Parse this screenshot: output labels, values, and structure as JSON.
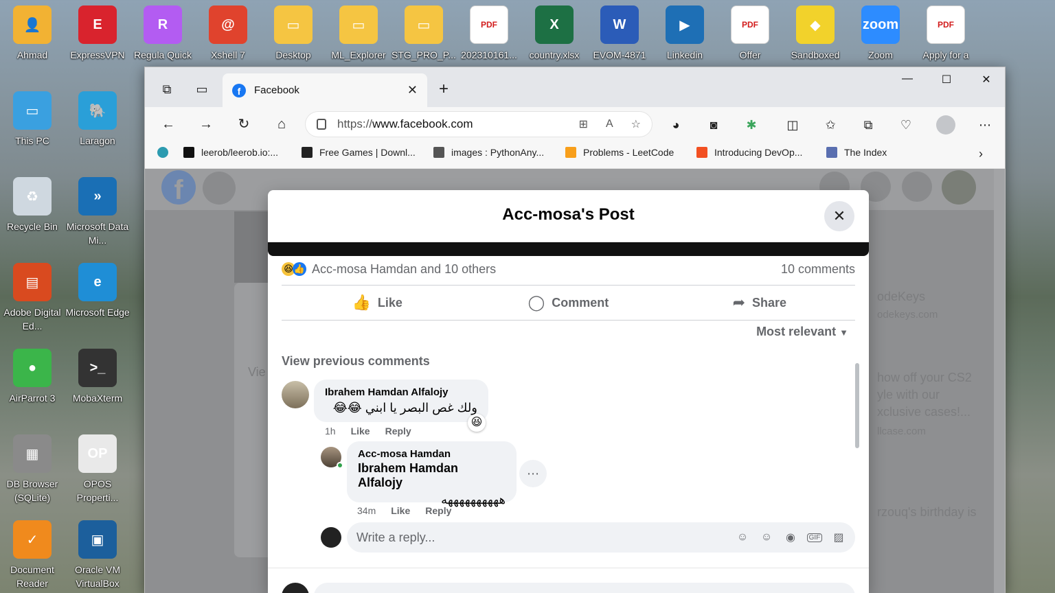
{
  "desktop": {
    "top_icons": [
      {
        "label": "Ahmad",
        "color": "#f2b233",
        "glyph": "👤"
      },
      {
        "label": "ExpressVPN",
        "color": "#d9232d",
        "glyph": "E"
      },
      {
        "label": "Regula Quick",
        "color": "#b35cf2",
        "glyph": "R"
      },
      {
        "label": "Xshell 7",
        "color": "#e0432d",
        "glyph": "@"
      },
      {
        "label": "Desktop",
        "color": "#f5c542",
        "glyph": "▭"
      },
      {
        "label": "ML_Explorer",
        "color": "#f5c542",
        "glyph": "▭"
      },
      {
        "label": "STG_PRO_P...",
        "color": "#f5c542",
        "glyph": "▭"
      },
      {
        "label": "202310161...",
        "color": "#ffffff",
        "glyph": "PDF"
      },
      {
        "label": "country.xlsx",
        "color": "#1d7044",
        "glyph": "X"
      },
      {
        "label": "EVOM-4871",
        "color": "#2b5cb8",
        "glyph": "W"
      },
      {
        "label": "Linkedin",
        "color": "#1e6fb5",
        "glyph": "▶"
      },
      {
        "label": "Offer",
        "color": "#ffffff",
        "glyph": "PDF"
      },
      {
        "label": "Sandboxed",
        "color": "#f2d22b",
        "glyph": "◆"
      },
      {
        "label": "Zoom",
        "color": "#2d8cff",
        "glyph": "zoom"
      },
      {
        "label": "Apply for a",
        "color": "#ffffff",
        "glyph": "PDF"
      }
    ],
    "left_icons_col1": [
      {
        "label": "This PC",
        "color": "#3aa0e0",
        "glyph": "▭"
      },
      {
        "label": "Recycle Bin",
        "color": "#cfd8e0",
        "glyph": "♻"
      },
      {
        "label": "Adobe Digital Ed...",
        "color": "#d94a1f",
        "glyph": "▤"
      },
      {
        "label": "AirParrot 3",
        "color": "#3bb54a",
        "glyph": "●"
      },
      {
        "label": "DB Browser (SQLite)",
        "color": "#8a8a8a",
        "glyph": "▦"
      },
      {
        "label": "Document Reader",
        "color": "#f08a1d",
        "glyph": "✓"
      }
    ],
    "left_icons_col2": [
      {
        "label": "Laragon",
        "color": "#2a9fd8",
        "glyph": "🐘"
      },
      {
        "label": "Microsoft Data Mi...",
        "color": "#1a6fb5",
        "glyph": "»"
      },
      {
        "label": "Microsoft Edge",
        "color": "#1f8ed6",
        "glyph": "e"
      },
      {
        "label": "MobaXterm",
        "color": "#333333",
        "glyph": ">_"
      },
      {
        "label": "OPOS Properti...",
        "color": "#e9e9e9",
        "glyph": "OP"
      },
      {
        "label": "Oracle VM VirtualBox",
        "color": "#1c5f9c",
        "glyph": "▣"
      }
    ]
  },
  "browser": {
    "tab_title": "Facebook",
    "url_prefix": "https://",
    "url_domain": "www.facebook.com",
    "favorites": [
      {
        "label": "leerob/leerob.io:...",
        "color": "#111111"
      },
      {
        "label": "Free Games | Downl...",
        "color": "#222222"
      },
      {
        "label": "images : PythonAny...",
        "color": "#555555"
      },
      {
        "label": "Problems - LeetCode",
        "color": "#f89f1b"
      },
      {
        "label": "Introducing DevOp...",
        "color": "#f25022"
      },
      {
        "label": "The Index",
        "color": "#5a6fb0"
      }
    ]
  },
  "facebook_bg": {
    "right_texts": [
      "odeKeys",
      "odekeys.com",
      "how off your CS2",
      "yle with our",
      "xclusive cases!...",
      "llcase.com",
      "rzouq's birthday is"
    ],
    "left_text": "Vie"
  },
  "modal": {
    "title": "Acc-mosa's Post",
    "reactions_text": "Acc-mosa Hamdan and 10 others",
    "comments_count": "10 comments",
    "like_label": "Like",
    "comment_label": "Comment",
    "share_label": "Share",
    "sort_label": "Most relevant",
    "view_previous": "View previous comments",
    "comment1": {
      "author": "Ibrahem Hamdan Alfalojy",
      "text": "ولك غص البصر يا ابني 😂😂",
      "time": "1h",
      "like": "Like",
      "reply": "Reply"
    },
    "comment2": {
      "author": "Acc-mosa Hamdan",
      "mention": "Ibrahem Hamdan Alfalojy",
      "text": "ههههههههههه",
      "time": "34m",
      "like": "Like",
      "reply": "Reply"
    },
    "reply_placeholder": "Write a reply..."
  }
}
